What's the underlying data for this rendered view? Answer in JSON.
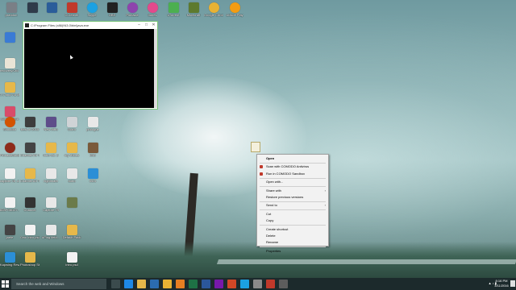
{
  "desktop": {
    "top_row": [
      {
        "label": "prandon",
        "icon": "user-folder-icon",
        "color": "#7a7f86"
      },
      {
        "label": "",
        "icon": "app-icon",
        "color": "#2f3b4a"
      },
      {
        "label": "",
        "icon": "app-icon",
        "color": "#2a5d9a"
      },
      {
        "label": "CCleaner",
        "icon": "ccleaner-icon",
        "color": "#c0392b"
      },
      {
        "label": "Skype",
        "icon": "skype-icon",
        "color": "#1ba1e2"
      },
      {
        "label": "OBS",
        "icon": "obs-icon",
        "color": "#222222"
      },
      {
        "label": "Pinnacle",
        "icon": "pinnacle-icon",
        "color": "#8e44ad"
      },
      {
        "label": "Itunes",
        "icon": "itunes-icon",
        "color": "#e34a8c"
      },
      {
        "label": "uTorrent",
        "icon": "utorrent-icon",
        "color": "#4caf50"
      },
      {
        "label": "Minecraft",
        "icon": "minecraft-icon",
        "color": "#5d7a2e"
      },
      {
        "label": "Google Chrome",
        "icon": "chrome-icon",
        "color": "#e8b234"
      },
      {
        "label": "Ubisoft Play",
        "icon": "ubisoft-icon",
        "color": "#f39c12"
      }
    ],
    "left_column": [
      {
        "label": "",
        "icon": "shortcut-icon",
        "color": "#3a7bd5"
      },
      {
        "label": "recovery/Old Sound",
        "icon": "file-icon",
        "color": "#e9e4d6"
      },
      {
        "label": "7.7 and 7.8 Music",
        "icon": "folder-icon",
        "color": "#e6b84a"
      },
      {
        "label": "Songs to Go",
        "icon": "music-icon",
        "color": "#d94c6a"
      }
    ],
    "middle_rows": [
      [
        {
          "label": "Shoutout",
          "icon": "shoutout-icon",
          "color": "#d35400"
        },
        {
          "label": "Best of 2015",
          "icon": "folder-icon",
          "color": "#3d3d3d"
        },
        {
          "label": "New Intro",
          "icon": "video-icon",
          "color": "#5e4d8a"
        },
        {
          "label": "Outro",
          "icon": "document-icon",
          "color": "#cfd3d6"
        },
        {
          "label": "prologue",
          "icon": "document-icon",
          "color": "#e8e8e8"
        }
      ],
      [
        {
          "label": "PinnacleStudio",
          "icon": "pinnacle-icon",
          "color": "#8e2b1b"
        },
        {
          "label": "Channel Art Template",
          "icon": "image-icon",
          "color": "#444444"
        },
        {
          "label": "Intro vol. 2",
          "icon": "folder-icon",
          "color": "#e6b84a"
        },
        {
          "label": "my vidoes",
          "icon": "folder-icon",
          "color": "#e6b84a"
        },
        {
          "label": "IMG",
          "icon": "image-icon",
          "color": "#7a5a3a"
        }
      ],
      [
        {
          "label": "capture 78 .cm2",
          "icon": "document-icon",
          "color": "#f2f2f2"
        },
        {
          "label": "Channel Art Templates",
          "icon": "folder-icon",
          "color": "#e6b84a"
        },
        {
          "label": "nightmare",
          "icon": "document-icon",
          "color": "#e8e8e8"
        },
        {
          "label": "outro",
          "icon": "document-icon",
          "color": "#e8e8e8"
        },
        {
          "label": "Intro",
          "icon": "image-icon",
          "color": "#2b8fd6"
        }
      ],
      [
        {
          "label": "828FC6D27...",
          "icon": "document-icon",
          "color": "#f2f2f2"
        },
        {
          "label": "Channel",
          "icon": "image-icon",
          "color": "#333333"
        },
        {
          "label": "Capture 79",
          "icon": "document-icon",
          "color": "#e8e8e8"
        },
        {
          "label": "",
          "icon": "image-icon",
          "color": "#6b7b4a"
        }
      ],
      [
        {
          "label": "jaefe",
          "icon": "user-icon",
          "color": "#444444"
        },
        {
          "label": "Own intro.psd",
          "icon": "document-icon",
          "color": "#f2f2f2"
        },
        {
          "label": "#Ping field...",
          "icon": "document-icon",
          "color": "#e8e8e8"
        },
        {
          "label": "Default Pack",
          "icon": "folder-icon",
          "color": "#e6b84a"
        }
      ],
      [
        {
          "label": "Kapwing Rewind IC...",
          "icon": "app-icon",
          "color": "#2b8fd6"
        },
        {
          "label": "Photoshop Stuff",
          "icon": "folder-icon",
          "color": "#e6b84a"
        },
        {
          "label": "",
          "icon": "blank",
          "color": "transparent"
        },
        {
          "label": "intro.psd",
          "icon": "document-icon",
          "color": "#f2f2f2"
        }
      ]
    ]
  },
  "console_window": {
    "title": "C:\\Program Files (x86)\\N3.0\\bin\\java.exe",
    "minimize": "–",
    "maximize": "□",
    "close": "✕"
  },
  "context_menu": {
    "items": [
      {
        "label": "Open",
        "bold": true,
        "icon": "",
        "submenu": false
      },
      {
        "sep": true
      },
      {
        "label": "Scan with COMODO Antivirus",
        "icon": "comodo-scan-icon",
        "icon_color": "#c0392b",
        "submenu": false
      },
      {
        "label": "Run in COMODO Sandbox",
        "icon": "comodo-sandbox-icon",
        "icon_color": "#c0392b",
        "submenu": false
      },
      {
        "sep": true
      },
      {
        "label": "Open with...",
        "submenu": false
      },
      {
        "sep": true
      },
      {
        "label": "Share with",
        "submenu": true
      },
      {
        "label": "Restore previous versions",
        "submenu": false
      },
      {
        "sep": true
      },
      {
        "label": "Send to",
        "submenu": true
      },
      {
        "sep": true
      },
      {
        "label": "Cut",
        "submenu": false
      },
      {
        "label": "Copy",
        "submenu": false
      },
      {
        "sep": true
      },
      {
        "label": "Create shortcut",
        "submenu": false
      },
      {
        "label": "Delete",
        "submenu": false
      },
      {
        "label": "Rename",
        "submenu": false
      },
      {
        "sep": true
      },
      {
        "label": "Properties",
        "submenu": false
      }
    ]
  },
  "taskbar": {
    "search_placeholder": "Search the web and Windows",
    "apps": [
      {
        "icon": "task-view-icon",
        "color": "#3b4b4d"
      },
      {
        "icon": "edge-icon",
        "color": "#1e88e5"
      },
      {
        "icon": "file-explorer-icon",
        "color": "#e6b84a"
      },
      {
        "icon": "store-icon",
        "color": "#2b6cb0"
      },
      {
        "icon": "chrome-icon",
        "color": "#e8b234"
      },
      {
        "icon": "media-icon",
        "color": "#e67e22"
      },
      {
        "icon": "excel-icon",
        "color": "#1e7145"
      },
      {
        "icon": "word-icon",
        "color": "#2b579a"
      },
      {
        "icon": "onenote-icon",
        "color": "#7719aa"
      },
      {
        "icon": "powerpoint-icon",
        "color": "#d24726"
      },
      {
        "icon": "skype-icon",
        "color": "#1ba1e2"
      },
      {
        "icon": "java-icon",
        "color": "#8a8a8a"
      },
      {
        "icon": "app-icon",
        "color": "#c0392b"
      },
      {
        "icon": "app-icon",
        "color": "#5d5d5d"
      }
    ],
    "clock_time": "8:16 PM",
    "clock_date": "3/11/2016"
  }
}
